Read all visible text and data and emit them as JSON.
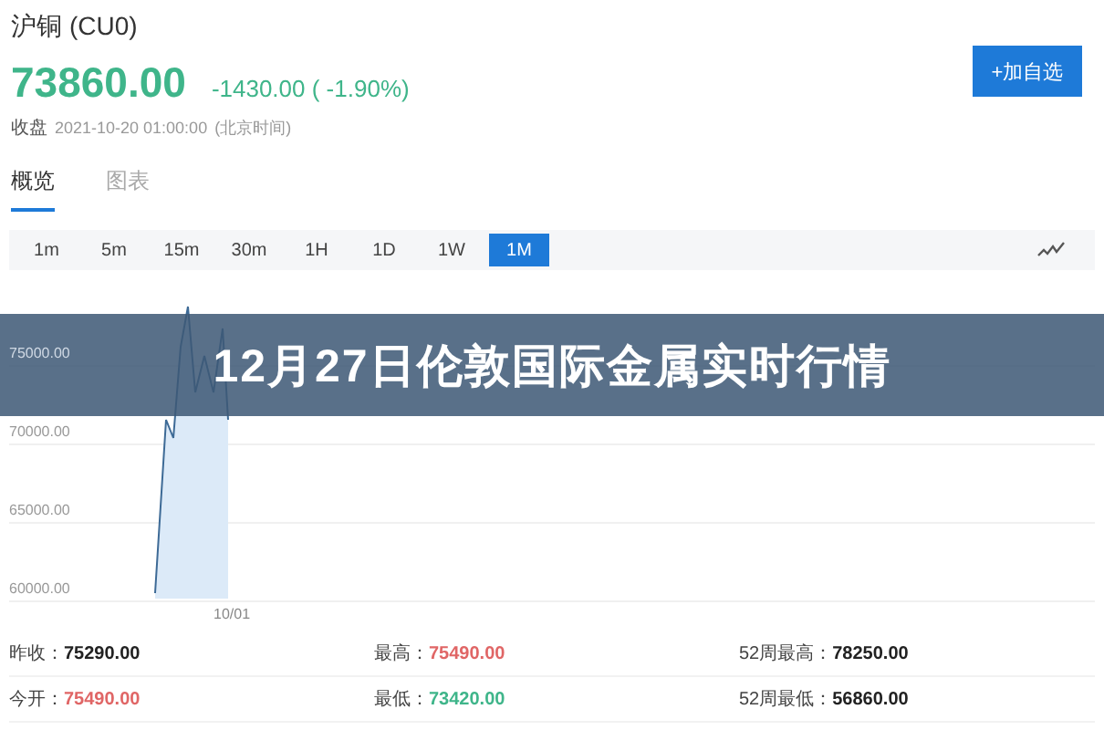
{
  "header": {
    "name": "沪铜",
    "code": "(CU0)",
    "price": "73860.00",
    "change": "-1430.00 ( -1.90%)",
    "status_label": "收盘",
    "time": "2021-10-20 01:00:00",
    "timezone": "(北京时间)",
    "add_button": "+加自选"
  },
  "tabs": [
    {
      "label": "概览",
      "selected": true
    },
    {
      "label": "图表",
      "selected": false
    }
  ],
  "periods": [
    {
      "label": "1m",
      "selected": false
    },
    {
      "label": "5m",
      "selected": false
    },
    {
      "label": "15m",
      "selected": false
    },
    {
      "label": "30m",
      "selected": false
    },
    {
      "label": "1H",
      "selected": false
    },
    {
      "label": "1D",
      "selected": false
    },
    {
      "label": "1W",
      "selected": false
    },
    {
      "label": "1M",
      "selected": true
    }
  ],
  "chart": {
    "y_labels": [
      "75000.00",
      "70000.00",
      "65000.00",
      "60000.00"
    ],
    "date_label": "10/01"
  },
  "banner": {
    "title": "12月27日伦敦国际金属实时行情"
  },
  "stats": [
    {
      "label": "昨收：",
      "value": "75290.00",
      "color": "#222222"
    },
    {
      "label": "最高：",
      "value": "75490.00",
      "color": "#e06666"
    },
    {
      "label": "52周最高：",
      "value": "78250.00",
      "color": "#222222"
    },
    {
      "label": "今开：",
      "value": "75490.00",
      "color": "#e06666"
    },
    {
      "label": "最低：",
      "value": "73420.00",
      "color": "#3fb58a"
    },
    {
      "label": "52周最低：",
      "value": "56860.00",
      "color": "#222222"
    }
  ]
}
